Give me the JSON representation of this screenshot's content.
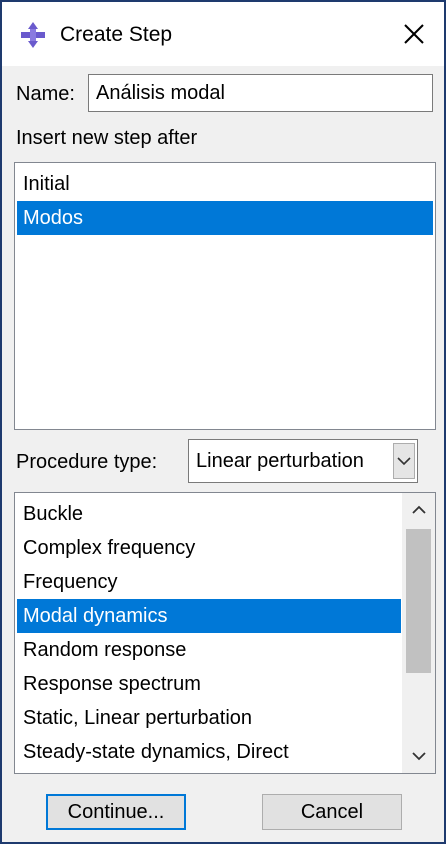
{
  "window": {
    "title": "Create Step",
    "accent_color": "#0078d7"
  },
  "name_field": {
    "label": "Name:",
    "value": "Análisis modal"
  },
  "insert_after": {
    "label": "Insert new step after",
    "items": [
      "Initial",
      "Modos"
    ],
    "selected": "Modos"
  },
  "procedure_type": {
    "label": "Procedure type:",
    "value": "Linear perturbation"
  },
  "procedures": {
    "items": [
      "Buckle",
      "Complex frequency",
      "Frequency",
      "Modal dynamics",
      "Random response",
      "Response spectrum",
      "Static, Linear perturbation",
      "Steady-state dynamics, Direct"
    ],
    "selected": "Modal dynamics"
  },
  "buttons": {
    "continue": "Continue...",
    "cancel": "Cancel"
  },
  "icons": {
    "app": "abaqus-step-icon",
    "close": "close-icon",
    "dropdown": "chevron-down-icon",
    "scroll_up": "chevron-up-icon",
    "scroll_down": "chevron-down-icon"
  }
}
